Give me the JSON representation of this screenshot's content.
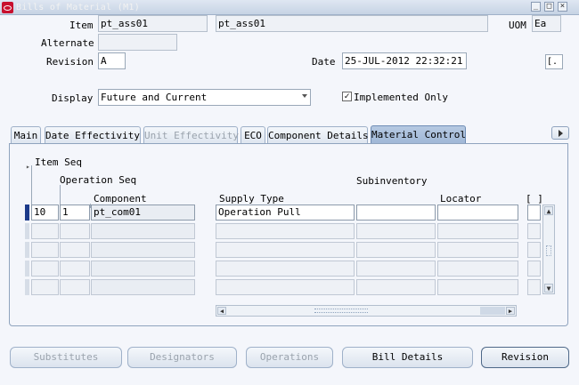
{
  "window": {
    "title": "Bills of Material (M1)",
    "controls": [
      "_",
      "□",
      "×"
    ]
  },
  "header": {
    "item_label": "Item",
    "item_value": "pt_ass01",
    "item_desc": "pt_ass01",
    "uom_label": "UOM",
    "uom_value": "Ea",
    "alternate_label": "Alternate",
    "alternate_value": "",
    "revision_label": "Revision",
    "revision_value": "A",
    "date_label": "Date",
    "date_value": "25-JUL-2012 22:32:21",
    "bracket_field": "[.",
    "display_label": "Display",
    "display_value": "Future and Current",
    "implemented_label": "Implemented Only",
    "implemented_checked": "✓"
  },
  "tabs": [
    {
      "label": "Main"
    },
    {
      "label": "Date Effectivity"
    },
    {
      "label": "Unit Effectivity"
    },
    {
      "label": "ECO"
    },
    {
      "label": "Component Details"
    },
    {
      "label": "Material Control"
    }
  ],
  "grid": {
    "item_seq_label": "Item Seq",
    "operation_seq_label": "Operation Seq",
    "component_label": "Component",
    "supply_type_label": "Supply Type",
    "subinventory_label": "Subinventory",
    "locator_label": "Locator",
    "flex_label": "[ ]",
    "rows": [
      {
        "item_seq": "10",
        "operation_seq": "1",
        "component": "pt_com01",
        "supply_type": "Operation Pull",
        "subinventory": "",
        "locator": ""
      },
      {
        "item_seq": "",
        "operation_seq": "",
        "component": "",
        "supply_type": "",
        "subinventory": "",
        "locator": ""
      },
      {
        "item_seq": "",
        "operation_seq": "",
        "component": "",
        "supply_type": "",
        "subinventory": "",
        "locator": ""
      },
      {
        "item_seq": "",
        "operation_seq": "",
        "component": "",
        "supply_type": "",
        "subinventory": "",
        "locator": ""
      },
      {
        "item_seq": "",
        "operation_seq": "",
        "component": "",
        "supply_type": "",
        "subinventory": "",
        "locator": ""
      }
    ]
  },
  "buttons": {
    "substitutes": "Substitutes",
    "designators": "Designators",
    "operations": "Operations",
    "bill_details": "Bill Details",
    "revision": "Revision"
  }
}
